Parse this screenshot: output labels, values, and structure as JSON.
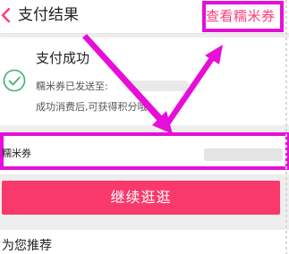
{
  "header": {
    "title": "支付结果",
    "view_coupon_link": "查看糯米券"
  },
  "result": {
    "status": "支付成功",
    "line1": "糯米券已发送至:",
    "line2": "成功消费后,可获得积分哦!"
  },
  "coupon": {
    "label": "糯米券"
  },
  "actions": {
    "continue_label": "继续逛逛"
  },
  "recommend": {
    "title": "为您推荐"
  },
  "colors": {
    "accent": "#f9386b",
    "highlight": "#e60ed8",
    "success": "#3cb371"
  }
}
